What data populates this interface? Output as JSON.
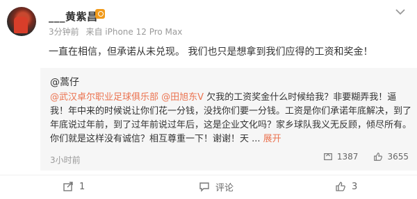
{
  "post": {
    "author": "___黄紫昌",
    "time": "3分钟前",
    "source": "来自 iPhone 12 Pro Max",
    "text": "一直在相信，但承诺从未兑现。 我们也只是想拿到我们应得的工资和奖金！"
  },
  "repost": {
    "author": "@蒿仔",
    "mention1": "@武汉卓尔职业足球俱乐部",
    "mention2": "@田旭东V",
    "body": " 欠我的工资奖金什么时候给我？非要糊弄我！逼我！年中来的时候说让你们花一分钱，没找你们要一分钱。工资是你们承诺年底解决，到了年底说过年前，到了过年前说过年后，这是企业文化吗？家乡球队我义无反顾，倾尽所有。你们就是这样没有诚信？相互尊重一下！谢谢！天 ...",
    "expand_label": "展开",
    "time": "3小时前",
    "reposts": "1387",
    "likes": "3655"
  },
  "actions": {
    "repost_label": "1",
    "comment_label": "评论",
    "like_label": "3"
  }
}
